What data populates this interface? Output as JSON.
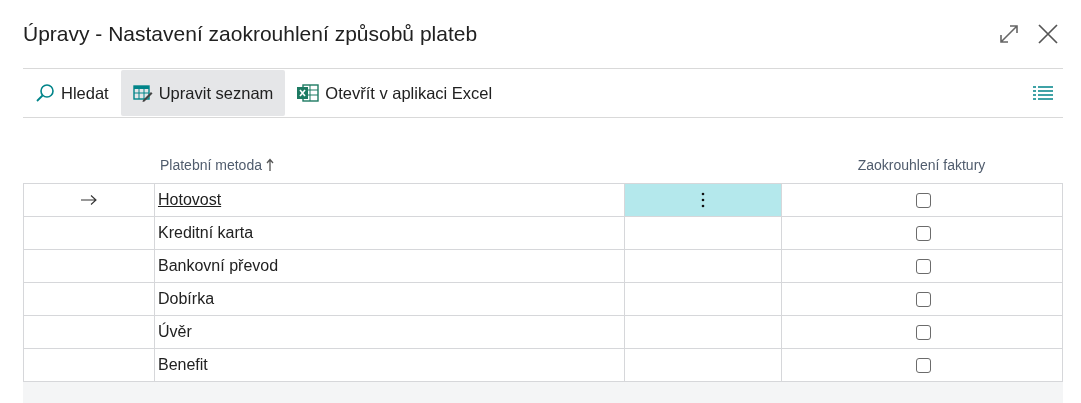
{
  "window": {
    "title": "Úpravy - Nastavení zaokrouhlení způsobů plateb"
  },
  "toolbar": [
    {
      "label": "Hledat",
      "kind": "search",
      "selected": false
    },
    {
      "label": "Upravit seznam",
      "kind": "edit-list",
      "selected": true
    },
    {
      "label": "Otevřít v aplikaci Excel",
      "kind": "excel",
      "selected": false
    }
  ],
  "table": {
    "columns": [
      {
        "label": "Platební metoda",
        "sorted_ascending": true
      },
      {
        "label": "Zaokrouhlení faktury",
        "sorted_ascending": false
      }
    ],
    "rows": [
      {
        "payment_method": "Hotovost",
        "selected": true,
        "invoice_rounding": false
      },
      {
        "payment_method": "Kreditní karta",
        "selected": false,
        "invoice_rounding": false
      },
      {
        "payment_method": "Bankovní převod",
        "selected": false,
        "invoice_rounding": false
      },
      {
        "payment_method": "Dobírka",
        "selected": false,
        "invoice_rounding": false
      },
      {
        "payment_method": "Úvěr",
        "selected": false,
        "invoice_rounding": false
      },
      {
        "payment_method": "Benefit",
        "selected": false,
        "invoice_rounding": false
      }
    ]
  }
}
